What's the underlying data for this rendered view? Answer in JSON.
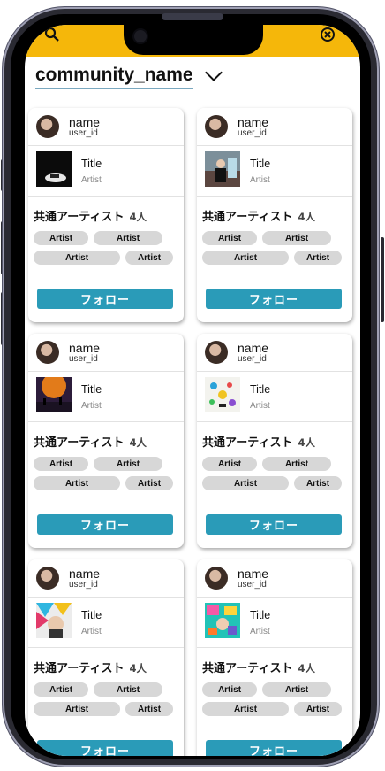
{
  "header": {
    "community_name": "community_name"
  },
  "cards": [
    {
      "name": "name",
      "user_id": "user_id",
      "song_title": "Title",
      "song_artist": "Artist",
      "common_label": "共通アーティスト",
      "common_count": "4人",
      "tags": [
        "Artist",
        "Artist",
        "Artist",
        "Artist"
      ],
      "follow_label": "フォロー",
      "jacket": "dark-stage"
    },
    {
      "name": "name",
      "user_id": "user_id",
      "song_title": "Title",
      "song_artist": "Artist",
      "common_label": "共通アーティスト",
      "common_count": "4人",
      "tags": [
        "Artist",
        "Artist",
        "Artist",
        "Artist"
      ],
      "follow_label": "フォロー",
      "jacket": "portrait-room"
    },
    {
      "name": "name",
      "user_id": "user_id",
      "song_title": "Title",
      "song_artist": "Artist",
      "common_label": "共通アーティスト",
      "common_count": "4人",
      "tags": [
        "Artist",
        "Artist",
        "Artist",
        "Artist"
      ],
      "follow_label": "フォロー",
      "jacket": "concert-orange"
    },
    {
      "name": "name",
      "user_id": "user_id",
      "song_title": "Title",
      "song_artist": "Artist",
      "common_label": "共通アーティスト",
      "common_count": "4人",
      "tags": [
        "Artist",
        "Artist",
        "Artist",
        "Artist"
      ],
      "follow_label": "フォロー",
      "jacket": "doodle-collage"
    },
    {
      "name": "name",
      "user_id": "user_id",
      "song_title": "Title",
      "song_artist": "Artist",
      "common_label": "共通アーティスト",
      "common_count": "4人",
      "tags": [
        "Artist",
        "Artist",
        "Artist",
        "Artist"
      ],
      "follow_label": "フォロー",
      "jacket": "colorful-face"
    },
    {
      "name": "name",
      "user_id": "user_id",
      "song_title": "Title",
      "song_artist": "Artist",
      "common_label": "共通アーティスト",
      "common_count": "4人",
      "tags": [
        "Artist",
        "Artist",
        "Artist",
        "Artist"
      ],
      "follow_label": "フォロー",
      "jacket": "pop-collage"
    }
  ],
  "colors": {
    "topbar": "#f5b70a",
    "follow_button": "#2a9bb8",
    "tag_bg": "#d7d7d7"
  },
  "icons": {
    "top_left": "search-icon",
    "top_right": "close-icon",
    "dropdown": "chevron-down-icon"
  }
}
